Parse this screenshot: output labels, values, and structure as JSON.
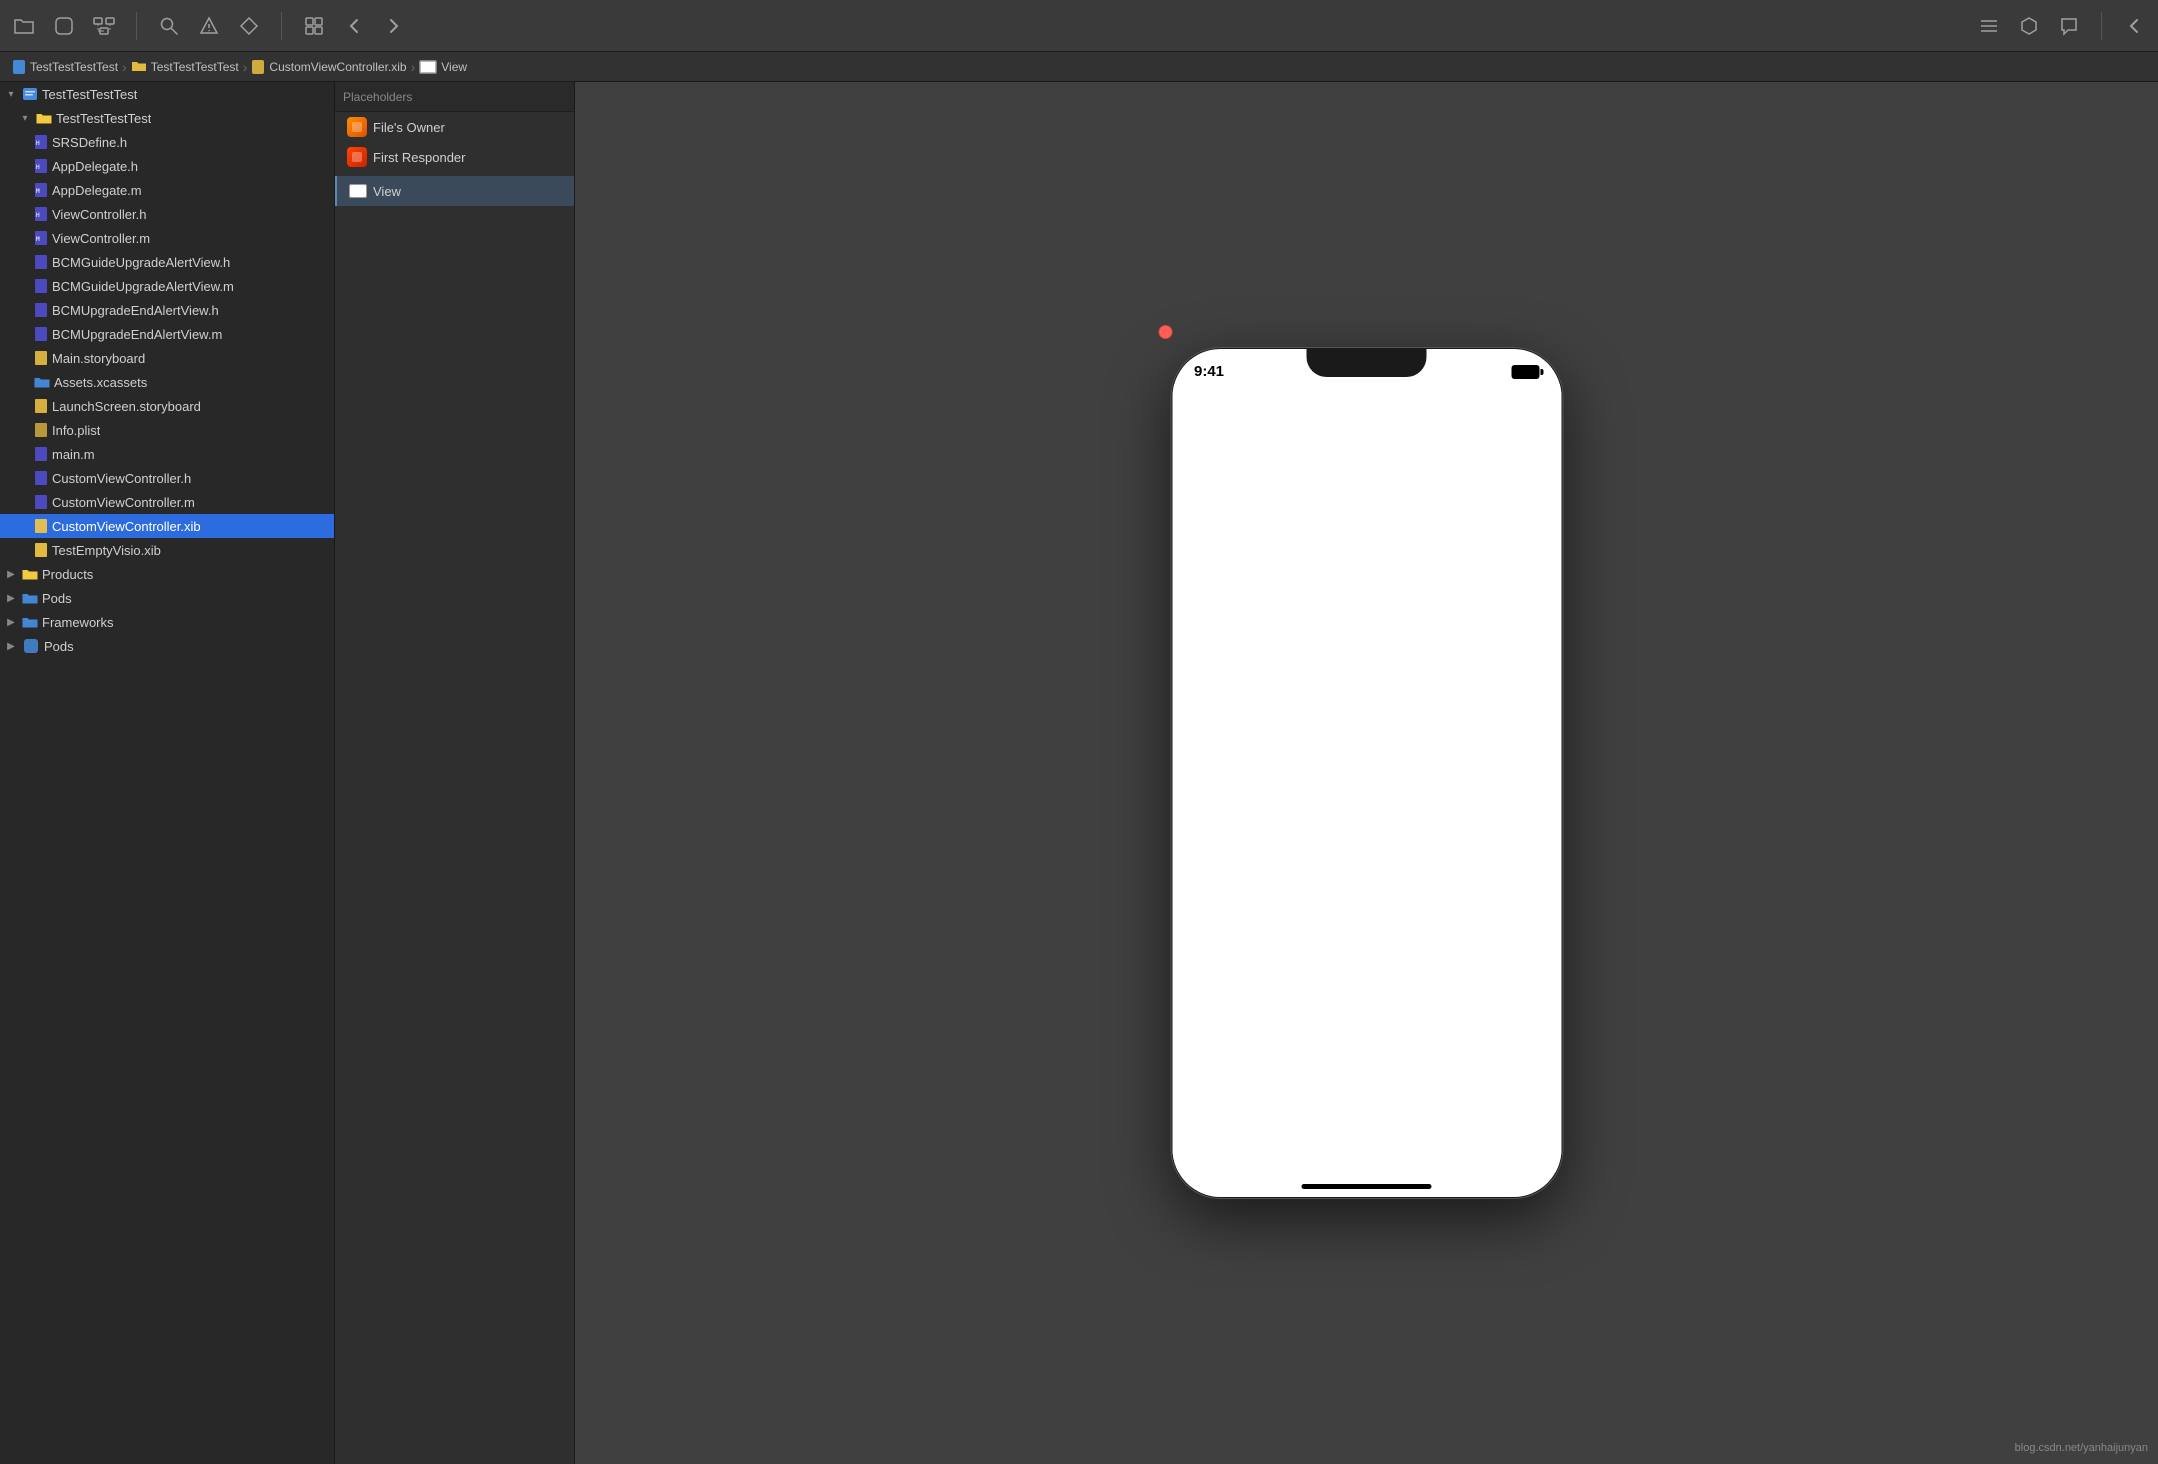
{
  "toolbar": {
    "icons": [
      {
        "name": "folder-icon",
        "symbol": "🗂",
        "label": "Folder"
      },
      {
        "name": "stop-icon",
        "symbol": "⬛",
        "label": "Stop"
      },
      {
        "name": "hierarchy-icon",
        "symbol": "⊞",
        "label": "Hierarchy"
      },
      {
        "name": "search-icon",
        "symbol": "🔍",
        "label": "Search"
      },
      {
        "name": "warning-icon",
        "symbol": "⚠",
        "label": "Warning"
      },
      {
        "name": "diamond-icon",
        "symbol": "◇",
        "label": "Diamond"
      },
      {
        "name": "list-icon",
        "symbol": "☰",
        "label": "List"
      },
      {
        "name": "shape-icon",
        "symbol": "⬡",
        "label": "Shape"
      },
      {
        "name": "comment-icon",
        "symbol": "💬",
        "label": "Comment"
      }
    ],
    "nav_back": "‹",
    "nav_forward": "›",
    "grid_icon": "⊞"
  },
  "breadcrumb": {
    "items": [
      {
        "label": "TestTestTestTest",
        "icon": "📄"
      },
      {
        "label": "TestTestTestTest",
        "icon": "📁"
      },
      {
        "label": "CustomViewController.xib",
        "icon": "📄"
      },
      {
        "label": "View",
        "icon": "▭"
      }
    ]
  },
  "sidebar": {
    "root": {
      "label": "TestTestTestTest",
      "icon": "▾",
      "color": "#4a9eff"
    },
    "groups": [
      {
        "label": "TestTestTestTest",
        "icon": "▾",
        "expanded": true,
        "folder_color": "#f5c842",
        "children": [
          {
            "label": "SRSDefine.h",
            "icon": "h",
            "color": "#a0a0ff",
            "indent": 2
          },
          {
            "label": "AppDelegate.h",
            "icon": "h",
            "color": "#a0a0ff",
            "indent": 2
          },
          {
            "label": "AppDelegate.m",
            "icon": "m",
            "color": "#a0a0ff",
            "indent": 2
          },
          {
            "label": "ViewController.h",
            "icon": "h",
            "color": "#a0a0ff",
            "indent": 2
          },
          {
            "label": "ViewController.m",
            "icon": "m",
            "color": "#a0a0ff",
            "indent": 2
          },
          {
            "label": "BCMGuideUpgradeAlertView.h",
            "icon": "h",
            "color": "#a0a0ff",
            "indent": 2
          },
          {
            "label": "BCMGuideUpgradeAlertView.m",
            "icon": "m",
            "color": "#a0a0ff",
            "indent": 2
          },
          {
            "label": "BCMUpgradeEndAlertView.h",
            "icon": "h",
            "color": "#a0a0ff",
            "indent": 2
          },
          {
            "label": "BCMUpgradeEndAlertView.m",
            "icon": "m",
            "color": "#a0a0ff",
            "indent": 2
          },
          {
            "label": "Main.storyboard",
            "icon": "sb",
            "color": "#f5c842",
            "indent": 2
          },
          {
            "label": "Assets.xcassets",
            "icon": "📁",
            "color": "#4a9eff",
            "indent": 2,
            "is_folder": true
          },
          {
            "label": "LaunchScreen.storyboard",
            "icon": "sb",
            "color": "#f5c842",
            "indent": 2
          },
          {
            "label": "Info.plist",
            "icon": "plist",
            "color": "#f5c842",
            "indent": 2
          },
          {
            "label": "main.m",
            "icon": "m",
            "color": "#a0a0ff",
            "indent": 2
          },
          {
            "label": "CustomViewController.h",
            "icon": "h",
            "color": "#a0a0ff",
            "indent": 2
          },
          {
            "label": "CustomViewController.m",
            "icon": "m",
            "color": "#a0a0ff",
            "indent": 2
          },
          {
            "label": "CustomViewController.xib",
            "icon": "xib",
            "color": "#f5c842",
            "indent": 2,
            "selected": true
          },
          {
            "label": "TestEmptyVisio.xib",
            "icon": "xib",
            "color": "#f5c842",
            "indent": 2
          }
        ]
      },
      {
        "label": "Products",
        "icon": "▶",
        "expanded": false,
        "folder_color": "#f5c842",
        "indent": 0
      },
      {
        "label": "Pods",
        "icon": "▶",
        "expanded": false,
        "folder_color": "#4a9eff",
        "indent": 0
      },
      {
        "label": "Frameworks",
        "icon": "▶",
        "expanded": false,
        "folder_color": "#4a9eff",
        "indent": 0
      },
      {
        "label": "Pods",
        "icon": "▶",
        "expanded": false,
        "folder_color": "#4a9eff",
        "indent": 0,
        "second_pods": true
      }
    ]
  },
  "doc_outline": {
    "section_label": "Placeholders",
    "items": [
      {
        "label": "File's Owner",
        "icon": "cube_orange",
        "indent": 1
      },
      {
        "label": "First Responder",
        "icon": "cube_orange_red",
        "indent": 1
      }
    ],
    "view_item": {
      "label": "View",
      "icon": "view",
      "indent": 0,
      "selected": true
    }
  },
  "canvas": {
    "phone": {
      "time": "9:41",
      "battery_visible": true
    }
  },
  "watermark": "blog.csdn.net/yanhaijunyan"
}
